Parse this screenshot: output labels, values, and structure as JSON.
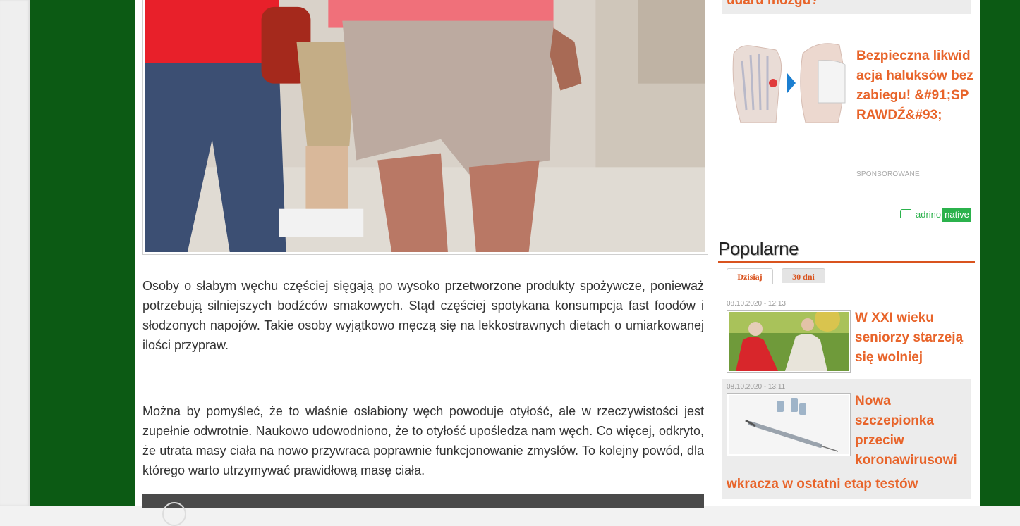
{
  "article": {
    "paragraph1": "Osoby o słabym węchu częściej sięgają po wysoko przetworzone produkty spożywcze, ponieważ potrzebują silniejszych bodźców smakowych. Stąd częściej spotykana konsumpcja fast foodów i słodzonych napojów. Takie osoby wyjątkowo męczą się na lekkostrawnych dietach o umiarkowanej ilości przypraw.",
    "paragraph2": "Można by pomyśleć, że to właśnie osłabiony węch powoduje otyłość, ale w rzeczywistości jest zupełnie odwrotnie. Naukowo udowodniono, że to otyłość upośledza nam węch. Co więcej, odkryto, że utrata masy ciała na nowo przywraca poprawnie funkcjonowanie zmysłów. To kolejny powód, dla którego warto utrzymywać prawidłową masę ciała."
  },
  "sidebar": {
    "ad_top_title": "udaru mózgu?",
    "ad": {
      "title": "Bezpieczna likwidacja haluksów bez zabiegu! &#91;SPRAWDŹ&#93;",
      "sponsored": "SPONSOROWANE"
    },
    "adrino": {
      "brand": "adrino",
      "native": "native"
    },
    "popular": {
      "title": "Popularne",
      "tabs": [
        {
          "label": "Dzisiaj"
        },
        {
          "label": "30 dni"
        }
      ],
      "items": [
        {
          "date": "08.10.2020 - 12:13",
          "title": "W XXI wieku seniorzy starzeją się wolniej"
        },
        {
          "date": "08.10.2020 - 13:11",
          "title_part1": "Nowa szczepionka przeciw koronawirusowi",
          "title_part2": "wkracza w ostatni etap testów"
        }
      ]
    }
  },
  "colors": {
    "accent": "#e8642a",
    "rule": "#d9531e",
    "frame": "#0c5a14",
    "adrino": "#2bb24c"
  }
}
